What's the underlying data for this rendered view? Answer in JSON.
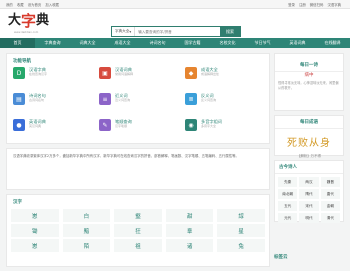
{
  "topbar": {
    "left": [
      "我的",
      "收藏",
      "设为首页",
      "加入收藏"
    ],
    "right": [
      "登录",
      "注册",
      "微信扫码",
      "汉语字典"
    ]
  },
  "logo": {
    "chars": [
      "大",
      "字",
      "典"
    ],
    "sub": "www.dazidian.com"
  },
  "search": {
    "select": "字典大全",
    "placeholder": "输入要查询的字/拼音",
    "button": "搜索"
  },
  "nav": [
    "首页",
    "字典查询",
    "词典大全",
    "成语大全",
    "诗词名句",
    "国学古籍",
    "名校文化",
    "节日节气",
    "英语词典",
    "在线翻译"
  ],
  "func": {
    "title": "功能导航",
    "items": [
      {
        "name": "汉语字典",
        "desc": "在线查询汉字",
        "icon": "D",
        "color": "#27a86b"
      },
      {
        "name": "汉语词典",
        "desc": "常用词语解释",
        "icon": "▣",
        "color": "#d74b3e"
      },
      {
        "name": "成语大全",
        "desc": "成语解释出处",
        "icon": "◆",
        "color": "#e68530"
      },
      {
        "name": "诗词名句",
        "desc": "古诗词名句",
        "icon": "▤",
        "color": "#4a8cd6"
      },
      {
        "name": "近义词",
        "desc": "近义词查询",
        "icon": "≡",
        "color": "#8c64c8"
      },
      {
        "name": "反义词",
        "desc": "反义词查询",
        "icon": "≣",
        "color": "#3a9fd9"
      },
      {
        "name": "英语词典",
        "desc": "英汉词典",
        "icon": "●",
        "color": "#3a6ed9"
      },
      {
        "name": "笔顺查询",
        "desc": "汉字笔顺",
        "icon": "✎",
        "color": "#8c64c8"
      },
      {
        "name": "多音字组词",
        "desc": "多音字大全",
        "icon": "◉",
        "color": "#2e8577"
      }
    ]
  },
  "intro": "汉语字典收录繁体汉字2万多个，囊括新华字典中所有汉字，新华字典可在线查询汉字的拼音、部首解释、笔画数、汉字笔顺、五笔编码、五行属性等。",
  "hanzi": {
    "title": "汉字",
    "chars": [
      "崽",
      "白",
      "壑",
      "甜",
      "諄",
      "锄",
      "黯",
      "狂",
      "羣",
      "星",
      "崽",
      "陌",
      "祖",
      "诸",
      "兔"
    ]
  },
  "poem": {
    "title": "每日一诗",
    "poem_title": "病中",
    "text": "怪得寻常淡无味，心神滋味淡无来，闲里偏从药裹开。"
  },
  "idiom": {
    "title": "每日成语",
    "text": "死败从身",
    "sub": "【解析】万不得"
  },
  "poets": {
    "title": "古今诗人",
    "names": [
      "先秦",
      "两汉",
      "魏晋",
      "南北朝",
      "隋代",
      "唐代",
      "五代",
      "宋代",
      "金朝",
      "元代",
      "明代",
      "清代"
    ]
  },
  "more": "标签云"
}
